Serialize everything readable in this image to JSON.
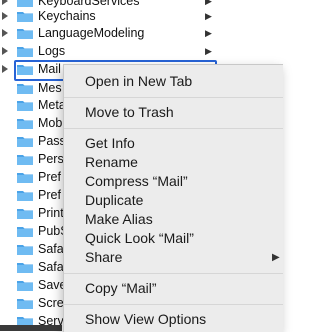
{
  "file_list": {
    "rows": [
      {
        "label": "KeyboardServices",
        "disclosure": true
      },
      {
        "label": "Keychains",
        "disclosure": true
      },
      {
        "label": "LanguageModeling",
        "disclosure": true
      },
      {
        "label": "Logs",
        "disclosure": true
      },
      {
        "label": "Mail",
        "disclosure": true,
        "selected": true
      },
      {
        "label": "Mes",
        "disclosure": false
      },
      {
        "label": "Meta",
        "disclosure": false
      },
      {
        "label": "Mob",
        "disclosure": false
      },
      {
        "label": "Pass",
        "disclosure": false
      },
      {
        "label": "Pers",
        "disclosure": false
      },
      {
        "label": "Pref",
        "disclosure": false
      },
      {
        "label": "Pref",
        "disclosure": false
      },
      {
        "label": "Print",
        "disclosure": false
      },
      {
        "label": "PubS",
        "disclosure": false
      },
      {
        "label": "Safa",
        "disclosure": false
      },
      {
        "label": "Safa",
        "disclosure": false
      },
      {
        "label": "Save",
        "disclosure": false
      },
      {
        "label": "Scre",
        "disclosure": false
      },
      {
        "label": "Serv",
        "disclosure": false
      }
    ],
    "folder_color": "#4aa3e8",
    "selection_color": "#2763d6"
  },
  "context_menu": {
    "items": [
      {
        "label": "Open in New Tab"
      },
      {
        "label": "Move to Trash"
      },
      {
        "label": "Get Info"
      },
      {
        "label": "Rename"
      },
      {
        "label": "Compress “Mail”"
      },
      {
        "label": "Duplicate"
      },
      {
        "label": "Make Alias"
      },
      {
        "label": "Quick Look “Mail”"
      },
      {
        "label": "Share",
        "submenu": true
      },
      {
        "label": "Copy “Mail”"
      },
      {
        "label": "Show View Options"
      }
    ],
    "submenu_arrow": "▶"
  }
}
